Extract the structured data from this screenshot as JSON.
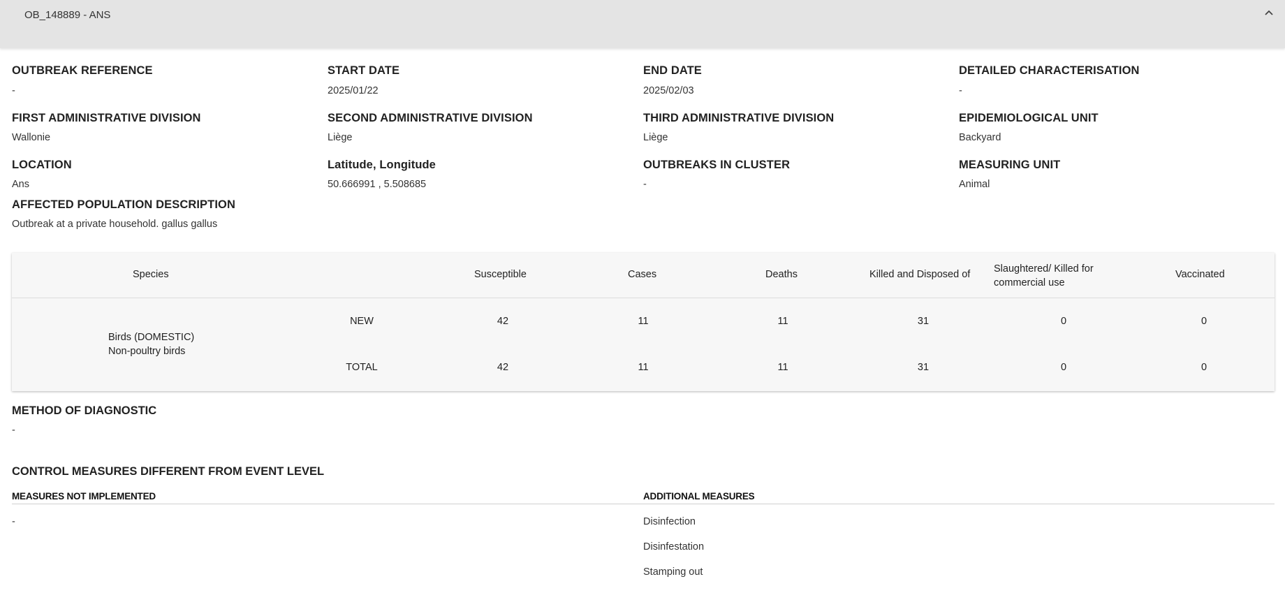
{
  "header": {
    "title": "OB_148889 - ANS"
  },
  "fields": {
    "outbreak_reference": {
      "label": "OUTBREAK REFERENCE",
      "value": "-"
    },
    "start_date": {
      "label": "START DATE",
      "value": "2025/01/22"
    },
    "end_date": {
      "label": "END DATE",
      "value": "2025/02/03"
    },
    "detailed_characterisation": {
      "label": "DETAILED CHARACTERISATION",
      "value": "-"
    },
    "first_admin_division": {
      "label": "FIRST ADMINISTRATIVE DIVISION",
      "value": "Wallonie"
    },
    "second_admin_division": {
      "label": "SECOND ADMINISTRATIVE DIVISION",
      "value": "Liège"
    },
    "third_admin_division": {
      "label": "THIRD ADMINISTRATIVE DIVISION",
      "value": "Liège"
    },
    "epidemiological_unit": {
      "label": "EPIDEMIOLOGICAL UNIT",
      "value": "Backyard"
    },
    "location": {
      "label": "LOCATION",
      "value": "Ans"
    },
    "lat_long": {
      "label": "Latitude, Longitude",
      "value": "50.666991 , 5.508685"
    },
    "outbreaks_in_cluster": {
      "label": "OUTBREAKS IN CLUSTER",
      "value": "-"
    },
    "measuring_unit": {
      "label": "MEASURING UNIT",
      "value": "Animal"
    },
    "affected_population": {
      "label": "AFFECTED POPULATION DESCRIPTION",
      "value": "Outbreak at a private household. gallus gallus"
    }
  },
  "table": {
    "headers": {
      "species": "Species",
      "susceptible": "Susceptible",
      "cases": "Cases",
      "deaths": "Deaths",
      "killed": "Killed and Disposed of",
      "slaughtered": "Slaughtered/ Killed for commercial use",
      "vaccinated": "Vaccinated"
    },
    "species_line1": "Birds (DOMESTIC)",
    "species_line2": "Non-poultry birds",
    "rows": [
      {
        "label": "NEW",
        "susceptible": "42",
        "cases": "11",
        "deaths": "11",
        "killed": "31",
        "slaughtered": "0",
        "vaccinated": "0"
      },
      {
        "label": "TOTAL",
        "susceptible": "42",
        "cases": "11",
        "deaths": "11",
        "killed": "31",
        "slaughtered": "0",
        "vaccinated": "0"
      }
    ]
  },
  "diagnostic": {
    "title": "METHOD OF DIAGNOSTIC",
    "value": "-"
  },
  "control_measures": {
    "title": "CONTROL MEASURES DIFFERENT FROM EVENT LEVEL",
    "not_implemented_title": "MEASURES NOT IMPLEMENTED",
    "not_implemented_value": "-",
    "additional_title": "ADDITIONAL MEASURES",
    "additional": [
      "Disinfection",
      "Disinfestation",
      "Stamping out"
    ]
  }
}
